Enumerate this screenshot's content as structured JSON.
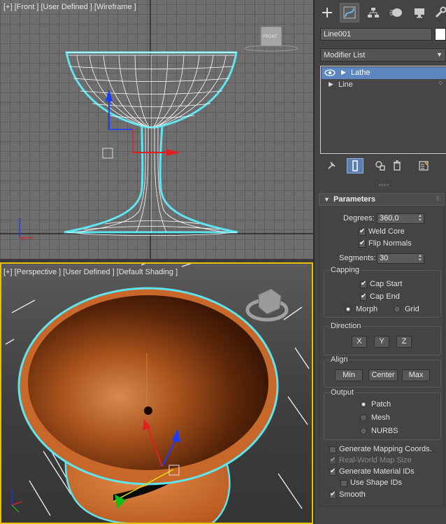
{
  "viewports": {
    "front": {
      "label": "[+] [Front ] [User Defined ] [Wireframe ]",
      "viewcube_label": "FRONT"
    },
    "perspective": {
      "label": "[+] [Perspective ] [User Defined ] [Default Shading ]"
    }
  },
  "panel": {
    "tabs": [
      {
        "name": "create",
        "icon": "plus-icon"
      },
      {
        "name": "modify",
        "icon": "modify-curve-icon",
        "active": true
      },
      {
        "name": "hierarchy",
        "icon": "hierarchy-icon"
      },
      {
        "name": "motion",
        "icon": "motion-icon"
      },
      {
        "name": "display",
        "icon": "display-monitor-icon"
      },
      {
        "name": "utilities",
        "icon": "wrench-icon"
      }
    ],
    "object_name": "Line001",
    "object_color": "#ffffff",
    "modifier_list": "Modifier List",
    "stack": [
      {
        "label": "Lathe",
        "selected": true
      },
      {
        "label": "Line",
        "selected": false
      }
    ],
    "parameters": {
      "title": "Parameters",
      "degrees_label": "Degrees:",
      "degrees_value": "360,0",
      "weld_core": "Weld Core",
      "flip_normals": "Flip Normals",
      "segments_label": "Segments:",
      "segments_value": "30",
      "capping": {
        "title": "Capping",
        "cap_start": "Cap Start",
        "cap_end": "Cap End",
        "morph": "Morph",
        "grid": "Grid"
      },
      "direction": {
        "title": "Direction",
        "x": "X",
        "y": "Y",
        "z": "Z"
      },
      "align": {
        "title": "Align",
        "min": "Min",
        "center": "Center",
        "max": "Max"
      },
      "output": {
        "title": "Output",
        "patch": "Patch",
        "mesh": "Mesh",
        "nurbs": "NURBS"
      },
      "generate_mapping": "Generate Mapping Coords.",
      "real_world": "Real-World Map Size",
      "generate_material_ids": "Generate Material IDs",
      "use_shape_ids": "Use Shape IDs",
      "smooth": "Smooth"
    }
  },
  "colors": {
    "selection_outline": "#5fe4f0",
    "active_viewport_border": "#e8c200",
    "stack_selected": "#5b86c0",
    "bowl_orange": "#c8672a"
  }
}
